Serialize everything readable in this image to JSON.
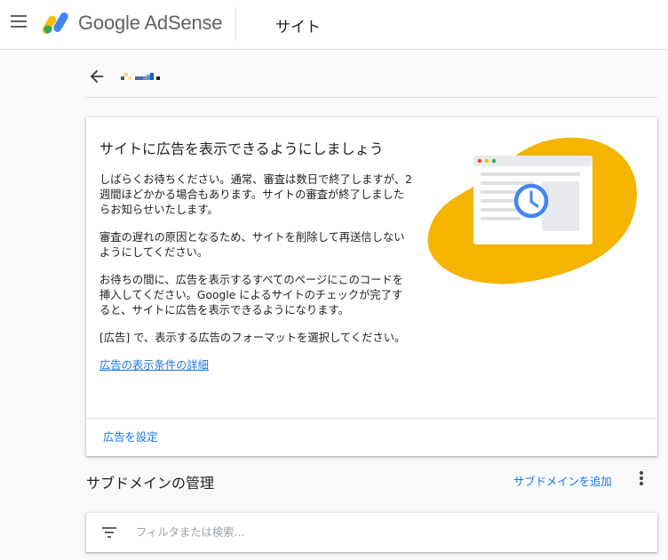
{
  "header": {
    "brand": "Google AdSense",
    "page_title": "サイト"
  },
  "notice_card": {
    "title": "サイトに広告を表示できるようにしましょう",
    "paragraphs": [
      "しばらくお待ちください。通常、審査は数日で終了しますが、2 週間ほどかかる場合もあります。サイトの審査が終了しましたらお知らせいたします。",
      "審査の遅れの原因となるため、サイトを削除して再送信しないようにしてください。",
      "お待ちの間に、広告を表示するすべてのページにこのコードを挿入してください。Google によるサイトのチェックが完了すると、サイトに広告を表示できるようになります。",
      "[広告] で、表示する広告のフォーマットを選択してください。"
    ],
    "detail_link": "広告の表示条件の詳細",
    "action_label": "広告を設定"
  },
  "subdomain_section": {
    "title": "サブドメインの管理",
    "add_label": "サブドメインを追加"
  },
  "filter": {
    "placeholder": "フィルタまたは検索..."
  },
  "icons": {
    "menu": "hamburger-menu-icon",
    "back": "arrow-back-icon",
    "more": "more-vert-icon",
    "filter": "filter-list-icon",
    "illustration": "clock-browser-illustration"
  },
  "colors": {
    "link": "#1a73e8",
    "illustration_blob": "#F4B400",
    "clock_accent": "#4285F4"
  }
}
